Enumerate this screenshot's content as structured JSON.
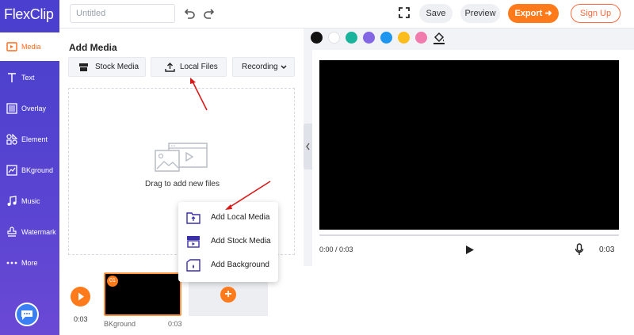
{
  "app": {
    "logo_text": "FlexClip"
  },
  "header": {
    "title_placeholder": "Untitled",
    "save_label": "Save",
    "preview_label": "Preview",
    "export_label": "Export",
    "signup_label": "Sign Up"
  },
  "sidebar": {
    "items": [
      {
        "label": "Media",
        "icon": "media-icon",
        "active": true
      },
      {
        "label": "Text",
        "icon": "text-icon"
      },
      {
        "label": "Overlay",
        "icon": "overlay-icon"
      },
      {
        "label": "Element",
        "icon": "element-icon"
      },
      {
        "label": "BKground",
        "icon": "background-icon"
      },
      {
        "label": "Music",
        "icon": "music-icon"
      },
      {
        "label": "Watermark",
        "icon": "watermark-icon"
      },
      {
        "label": "More",
        "icon": "more-icon"
      }
    ]
  },
  "media_panel": {
    "title": "Add Media",
    "tabs": {
      "stock": "Stock Media",
      "local": "Local Files",
      "recording": "Recording"
    },
    "drop_label": "Drag to add new files"
  },
  "colors": [
    "#111111",
    "#ffffff",
    "#1ab39b",
    "#8366e3",
    "#1e96f0",
    "#fbbd1c",
    "#f07bad"
  ],
  "player": {
    "time_current": "0:00 / 0:03",
    "duration": "0:03"
  },
  "timeline": {
    "play_time": "0:03",
    "clip": {
      "badge": "01",
      "name": "BKground",
      "duration": "0:03"
    }
  },
  "popup_menu": {
    "items": [
      {
        "label": "Add Local Media",
        "icon": "local-media-icon"
      },
      {
        "label": "Add Stock Media",
        "icon": "stock-media-icon"
      },
      {
        "label": "Add Background",
        "icon": "background-icon"
      }
    ]
  },
  "accent": "#ff7a1a",
  "brand": "#4b3fcf"
}
